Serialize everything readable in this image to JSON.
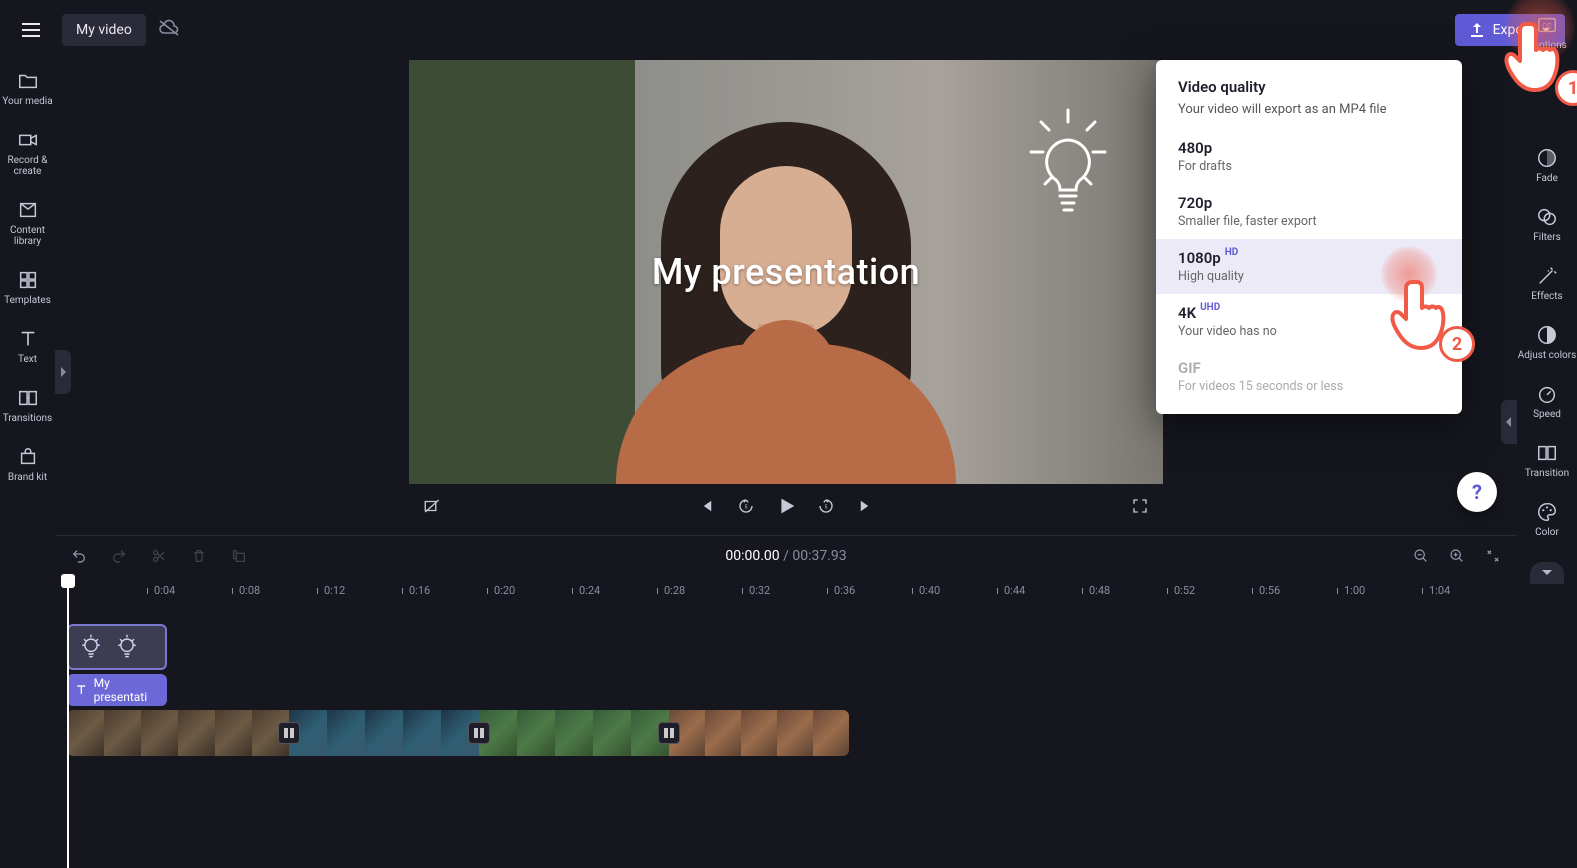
{
  "project": {
    "name": "My video"
  },
  "export": {
    "button_label": "Export",
    "popover": {
      "title": "Video quality",
      "subtitle": "Your video will export as an MP4 file",
      "options": [
        {
          "name": "480p",
          "badge": "",
          "desc": "For drafts"
        },
        {
          "name": "720p",
          "badge": "",
          "desc": "Smaller file, faster export"
        },
        {
          "name": "1080p",
          "badge": "HD",
          "desc": "High quality",
          "selected": true
        },
        {
          "name": "4K",
          "badge": "UHD",
          "desc": "Your video has no"
        },
        {
          "name": "GIF",
          "badge": "",
          "desc": "For videos 15 seconds or less",
          "disabled": true
        }
      ]
    }
  },
  "left_sidebar": {
    "items": [
      {
        "label": "Your media"
      },
      {
        "label": "Record & create"
      },
      {
        "label": "Content library"
      },
      {
        "label": "Templates"
      },
      {
        "label": "Text"
      },
      {
        "label": "Transitions"
      },
      {
        "label": "Brand kit"
      }
    ]
  },
  "right_sidebar": {
    "items": [
      {
        "label": "Captions"
      },
      {
        "label": "Fade"
      },
      {
        "label": "Filters"
      },
      {
        "label": "Effects"
      },
      {
        "label": "Adjust colors"
      },
      {
        "label": "Speed"
      },
      {
        "label": "Transition"
      },
      {
        "label": "Color"
      }
    ]
  },
  "canvas": {
    "overlay_text": "My presentation"
  },
  "timeline": {
    "current": "00:00.00",
    "duration": "00:37.93",
    "ruler_ticks": [
      "0:04",
      "0:08",
      "0:12",
      "0:16",
      "0:20",
      "0:24",
      "0:28",
      "0:32",
      "0:36",
      "0:40",
      "0:44",
      "0:48",
      "0:52",
      "0:56",
      "1:00",
      "1:04"
    ],
    "text_clip_label": "My presentati"
  },
  "annotations": {
    "step1": "1",
    "step2": "2"
  }
}
